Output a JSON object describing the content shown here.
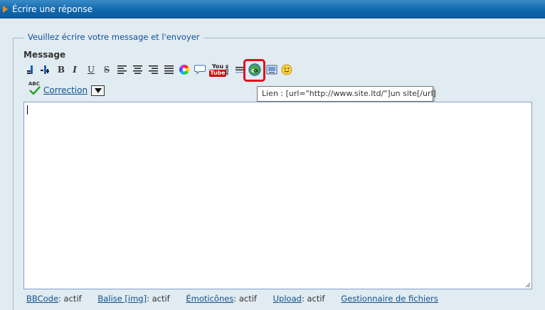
{
  "header": {
    "title": "Écrire une réponse"
  },
  "fieldset": {
    "legend": "Veuillez écrire votre message et l'envoyer"
  },
  "message": {
    "label": "Message",
    "value": ""
  },
  "toolbar": {
    "buttons": [
      "outdent-icon",
      "indent-icon",
      "bold-button",
      "italic-button",
      "underline-button",
      "strikethrough-button",
      "align-left-icon",
      "align-center-icon",
      "align-right-icon",
      "justify-icon",
      "color-wheel-icon",
      "quote-bubble-icon",
      "youtube-icon",
      "list-icon",
      "link-icon",
      "image-icon",
      "smiley-icon"
    ],
    "bold": "B",
    "italic": "I",
    "underline": "U",
    "strike": "S",
    "youtube_top": "You",
    "youtube_bottom": "Tube",
    "wide": "WIDE",
    "highlight_color": "#e0101a"
  },
  "tooltip": {
    "text": "Lien : [url=\"http://www.site.ltd/\"]un site[/url]"
  },
  "spellcheck": {
    "abc": "ABC",
    "link": "Correction"
  },
  "footer": {
    "bbcode_link": "BBCode",
    "bbcode_status": ": actif",
    "img_link": "Balise [img]",
    "img_status": ": actif",
    "emoticons_link": "Émoticônes",
    "emoticons_status": ": actif",
    "upload_link": "Upload",
    "upload_status": ": actif",
    "files_link": "Gestionnaire de fichiers"
  }
}
